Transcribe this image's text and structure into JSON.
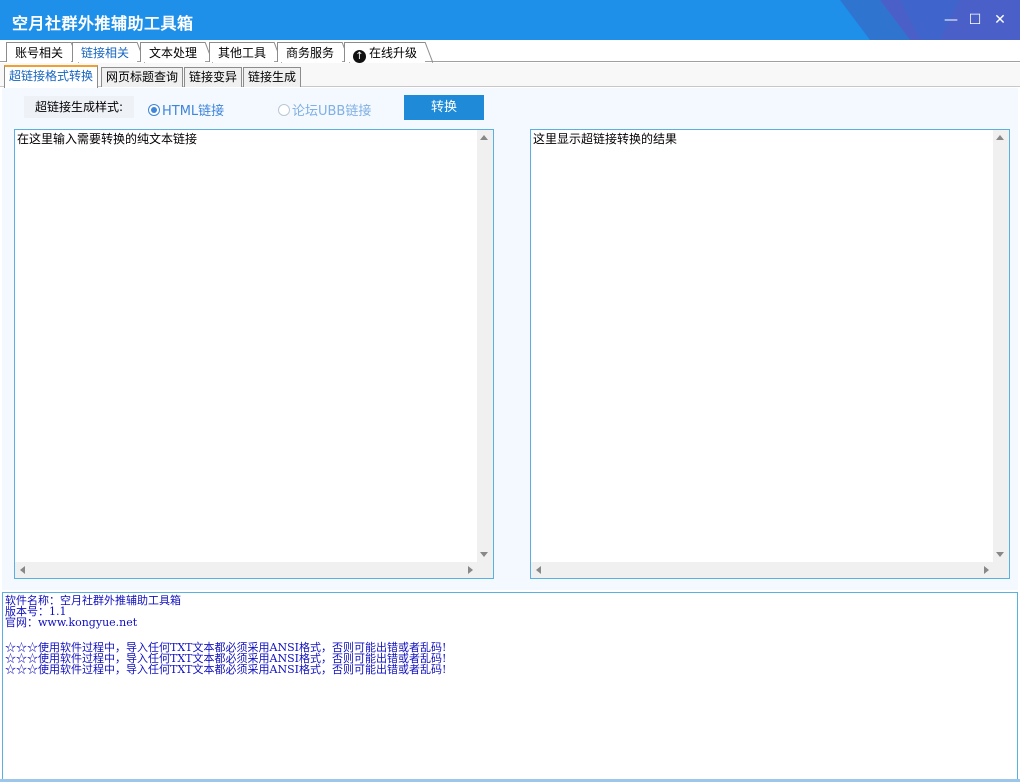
{
  "window": {
    "title": "空月社群外推辅助工具箱",
    "controls": {
      "minimize": "—",
      "maximize": "☐",
      "close": "✕"
    }
  },
  "colors": {
    "title_bar": "#1e90ea",
    "accent": "#3f86d8",
    "button": "#1e8ad8",
    "log_text": "#1010c0"
  },
  "main_tabs": [
    {
      "label": "账号相关"
    },
    {
      "label": "链接相关",
      "active": true
    },
    {
      "label": "文本处理"
    },
    {
      "label": "其他工具"
    },
    {
      "label": "商务服务"
    },
    {
      "label": "在线升级",
      "icon": "upload-arrow-icon"
    }
  ],
  "sub_tabs": [
    {
      "label": "超链接格式转换",
      "active": true
    },
    {
      "label": "网页标题查询"
    },
    {
      "label": "链接变异"
    },
    {
      "label": "链接生成"
    }
  ],
  "options": {
    "label": "超链接生成样式:",
    "radio_html": {
      "label": "HTML链接",
      "checked": true
    },
    "radio_ubb": {
      "label": "论坛UBB链接",
      "checked": false
    },
    "convert_button": "转换"
  },
  "input_box": {
    "text": "在这里输入需要转换的纯文本链接"
  },
  "output_box": {
    "text": "这里显示超链接转换的结果"
  },
  "log": {
    "lines": [
      "软件名称：空月社群外推辅助工具箱",
      "版本号：1.1",
      "官网：www.kongyue.net"
    ],
    "warnings": [
      "☆☆☆使用软件过程中，导入任何TXT文本都必须采用ANSI格式，否则可能出错或者乱码!",
      "☆☆☆使用软件过程中，导入任何TXT文本都必须采用ANSI格式，否则可能出错或者乱码!",
      "☆☆☆使用软件过程中，导入任何TXT文本都必须采用ANSI格式，否则可能出错或者乱码!"
    ]
  }
}
